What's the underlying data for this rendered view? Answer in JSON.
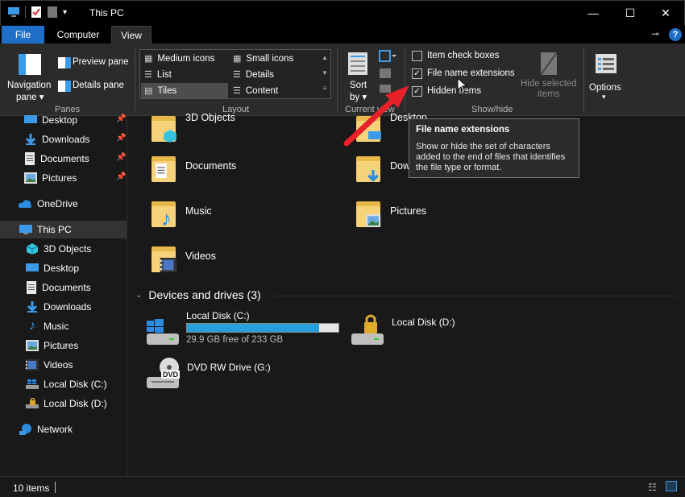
{
  "window": {
    "title": "This PC",
    "minimize": "—",
    "maximize": "☐",
    "close": "✕"
  },
  "tabs": {
    "file": "File",
    "computer": "Computer",
    "view": "View"
  },
  "ribbon": {
    "panes": {
      "group_label": "Panes",
      "navigation_pane": "Navigation",
      "navigation_pane_2": "pane ▾",
      "preview_pane": "Preview pane",
      "details_pane": "Details pane"
    },
    "layout": {
      "group_label": "Layout",
      "items": [
        "Medium icons",
        "Small icons",
        "List",
        "Details",
        "Tiles",
        "Content"
      ],
      "selected": "Tiles"
    },
    "current_view": {
      "group_label": "Current view",
      "sort_by": "Sort",
      "sort_by_2": "by ▾"
    },
    "show_hide": {
      "group_label": "Show/hide",
      "item_check_boxes": "Item check boxes",
      "file_name_extensions": "File name extensions",
      "hidden_items": "Hidden items",
      "hide_selected": "Hide selected",
      "hide_selected_2": "items",
      "item_check_boxes_checked": false,
      "file_name_extensions_checked": true,
      "hidden_items_checked": true
    },
    "options": {
      "label": "Options",
      "arrow": "▾"
    }
  },
  "nav": {
    "quick_access": [
      {
        "label": "Desktop",
        "icon": "desktop-icon",
        "pinned": true
      },
      {
        "label": "Downloads",
        "icon": "download-icon",
        "pinned": true
      },
      {
        "label": "Documents",
        "icon": "document-icon",
        "pinned": true
      },
      {
        "label": "Pictures",
        "icon": "pictures-icon",
        "pinned": true
      }
    ],
    "onedrive": "OneDrive",
    "this_pc": "This PC",
    "this_pc_children": [
      {
        "label": "3D Objects"
      },
      {
        "label": "Desktop"
      },
      {
        "label": "Documents"
      },
      {
        "label": "Downloads"
      },
      {
        "label": "Music"
      },
      {
        "label": "Pictures"
      },
      {
        "label": "Videos"
      },
      {
        "label": "Local Disk (C:)"
      },
      {
        "label": "Local Disk (D:)"
      }
    ],
    "network": "Network"
  },
  "folders": [
    {
      "label": "3D Objects"
    },
    {
      "label": "Desktop"
    },
    {
      "label": "Documents"
    },
    {
      "label": "Downloads"
    },
    {
      "label": "Music"
    },
    {
      "label": "Pictures"
    },
    {
      "label": "Videos"
    }
  ],
  "devices": {
    "header": "Devices and drives (3)",
    "drives": [
      {
        "label": "Local Disk (C:)",
        "free": "29.9 GB free of 233 GB",
        "used_fraction": 0.87
      },
      {
        "label": "Local Disk (D:)"
      },
      {
        "label": "DVD RW Drive (G:)",
        "badge": "DVD"
      }
    ]
  },
  "tooltip": {
    "title": "File name extensions",
    "body": "Show or hide the set of characters added to the end of files that identifies the file type or format."
  },
  "status": {
    "items": "10 items"
  },
  "colors": {
    "accent": "#1e6fc8",
    "arrow": "#e8202a",
    "drive_fill": "#26a0da"
  }
}
